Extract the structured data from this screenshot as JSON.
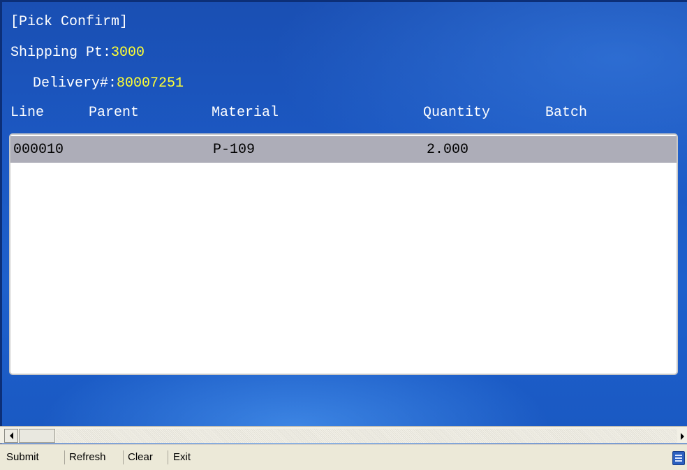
{
  "header": {
    "title": "[Pick Confirm]",
    "shipping_label": "Shipping Pt:",
    "shipping_value": "3000",
    "delivery_label": "Delivery#:",
    "delivery_value": "80007251"
  },
  "table": {
    "columns": [
      "Line",
      "Parent",
      "Material",
      "Quantity",
      "Batch"
    ],
    "rows": [
      {
        "line": "000010",
        "parent": "",
        "material": "P-109",
        "quantity": "2.000",
        "batch": ""
      }
    ]
  },
  "menu": {
    "items": [
      "Submit",
      "Refresh",
      "Clear",
      "Exit"
    ]
  },
  "icons": {
    "scroll_left": "arrow-left-icon",
    "scroll_right": "arrow-right-icon",
    "keyboard": "keyboard-icon"
  },
  "colors": {
    "value_text": "#ffff33",
    "selected_row": "#adadb8"
  }
}
